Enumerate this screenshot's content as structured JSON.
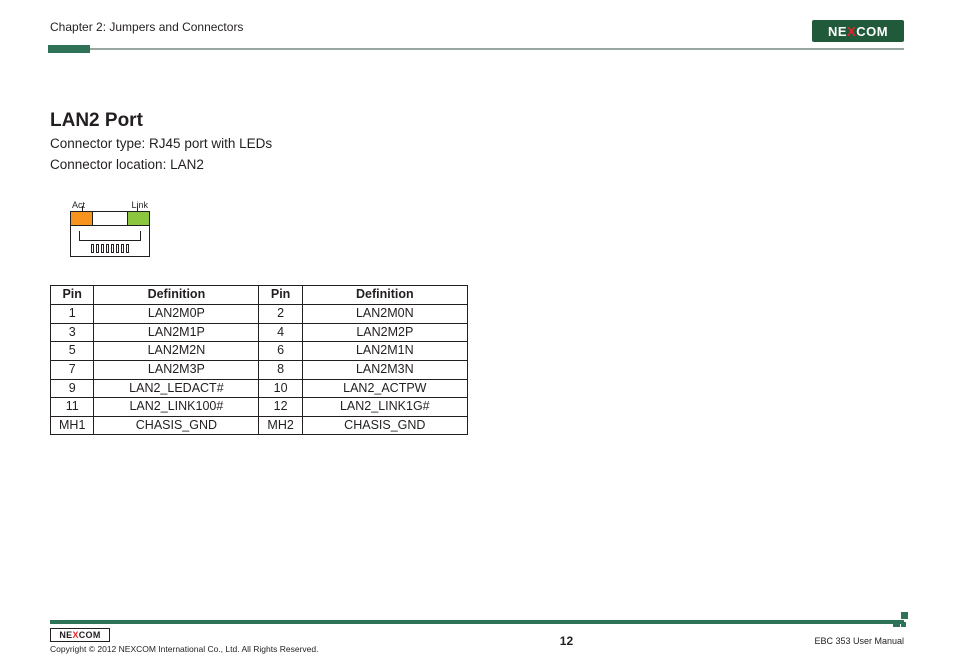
{
  "header": {
    "chapter_label": "Chapter 2: Jumpers and Connectors",
    "brand": {
      "pre": "NE",
      "x": "X",
      "post": "COM"
    }
  },
  "section": {
    "title": "LAN2 Port",
    "lines": [
      "Connector type: RJ45 port with LEDs",
      "Connector location: LAN2"
    ]
  },
  "diagram": {
    "act_label": "Act",
    "link_label": "Link"
  },
  "table": {
    "headers": [
      "Pin",
      "Definition",
      "Pin",
      "Definition"
    ],
    "rows": [
      [
        "1",
        "LAN2M0P",
        "2",
        "LAN2M0N"
      ],
      [
        "3",
        "LAN2M1P",
        "4",
        "LAN2M2P"
      ],
      [
        "5",
        "LAN2M2N",
        "6",
        "LAN2M1N"
      ],
      [
        "7",
        "LAN2M3P",
        "8",
        "LAN2M3N"
      ],
      [
        "9",
        "LAN2_LEDACT#",
        "10",
        "LAN2_ACTPW"
      ],
      [
        "11",
        "LAN2_LINK100#",
        "12",
        "LAN2_LINK1G#"
      ],
      [
        "MH1",
        "CHASIS_GND",
        "MH2",
        "CHASIS_GND"
      ]
    ]
  },
  "footer": {
    "brand": {
      "pre": "NE",
      "x": "X",
      "post": "COM"
    },
    "copyright": "Copyright © 2012 NEXCOM International Co., Ltd. All Rights Reserved.",
    "page_number": "12",
    "manual": "EBC 353 User Manual"
  }
}
